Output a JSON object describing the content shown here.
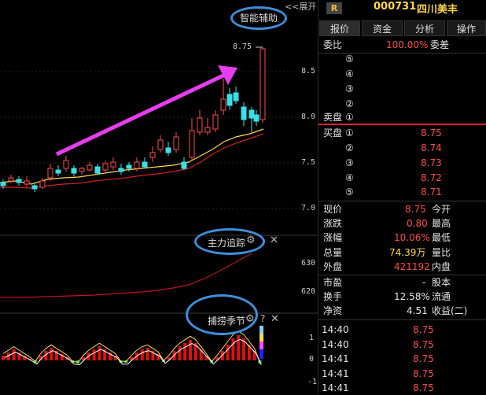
{
  "toolbar": {
    "expand_label": "<<展开"
  },
  "main_chart": {
    "assist_label": "智能辅助",
    "last_price_label": "8.75",
    "y_ticks": [
      "8.5",
      "8.0",
      "7.5",
      "7.0"
    ]
  },
  "indicator1": {
    "title": "主力追踪",
    "y_ticks": [
      "630",
      "620"
    ]
  },
  "indicator2": {
    "title": "捕捞季节",
    "help": "?",
    "y_ticks": [
      "1",
      "0",
      "-1"
    ]
  },
  "quote": {
    "badge": "R",
    "code": "000731",
    "name": "四川美丰",
    "tabs": [
      "报价",
      "资金",
      "分析",
      "操作"
    ],
    "weibi_label": "委比",
    "weibi_value": "100.00%",
    "weicha_label": "委差",
    "sell_label": "卖盘",
    "sell_levels": [
      "⑤",
      "④",
      "③",
      "②",
      "①"
    ],
    "buy_label": "买盘",
    "buy_levels": [
      "①",
      "②",
      "③",
      "④",
      "⑤"
    ],
    "buy_prices": [
      "8.75",
      "8.74",
      "8.73",
      "8.72",
      "8.71"
    ],
    "stats": [
      {
        "l": "现价",
        "v": "8.75",
        "r": "今开",
        "color": "red"
      },
      {
        "l": "涨跌",
        "v": "0.80",
        "r": "最高",
        "color": "red"
      },
      {
        "l": "涨幅",
        "v": "10.06%",
        "r": "最低",
        "color": "red"
      },
      {
        "l": "总量",
        "v": "74.39万",
        "r": "量比",
        "color": "yellow"
      },
      {
        "l": "外盘",
        "v": "421192",
        "r": "内盘",
        "color": "red"
      }
    ],
    "stats2": [
      {
        "l": "市盈",
        "v": "-",
        "r": "股本",
        "color": "white"
      },
      {
        "l": "换手",
        "v": "12.58%",
        "r": "流通",
        "color": "white"
      },
      {
        "l": "净资",
        "v": "4.51",
        "r": "收益(二)",
        "color": "white"
      }
    ],
    "ticks": [
      {
        "t": "14:40",
        "p": "8.75"
      },
      {
        "t": "14:40",
        "p": "8.75"
      },
      {
        "t": "14:41",
        "p": "8.75"
      },
      {
        "t": "14:41",
        "p": "8.75"
      },
      {
        "t": "14:41",
        "p": "8.75"
      }
    ]
  },
  "colors": {
    "up": "#ff4b4b",
    "down": "#38e0e8",
    "ma1": "#ffd84a",
    "ma2": "#d02020",
    "arrow": "#e83cf0",
    "highlight": "#3c8fdd"
  }
}
